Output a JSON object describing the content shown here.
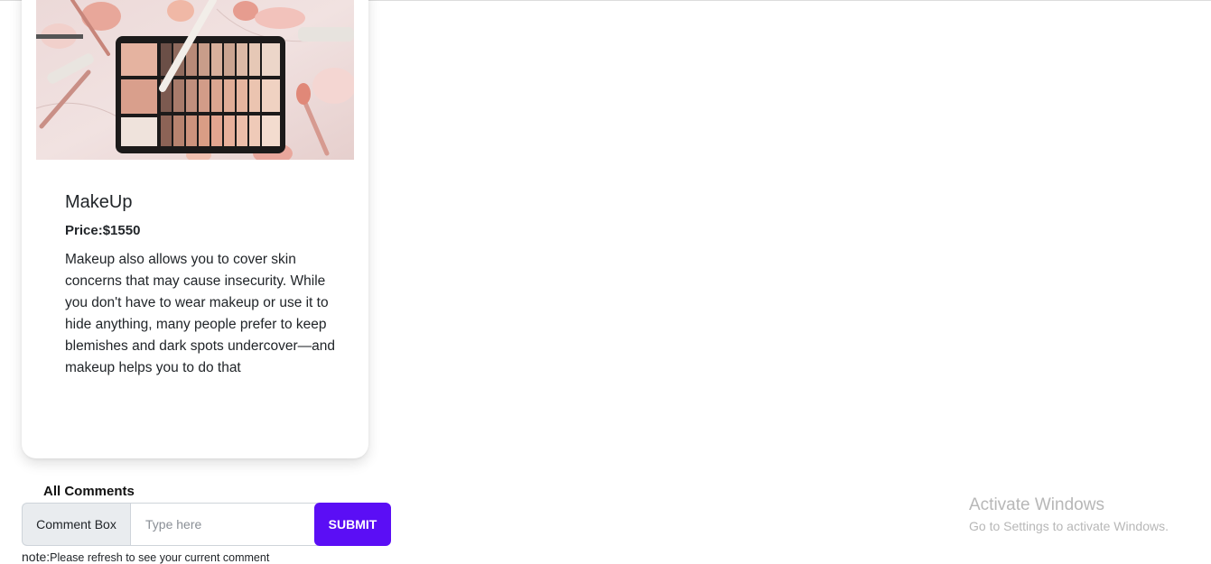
{
  "product": {
    "image_alt": "makeup palette and brushes",
    "title": "MakeUp",
    "price_label": "Price:",
    "price_value": "$1550",
    "description": "Makeup also allows you to cover skin concerns that may cause insecurity. While you don't have to wear makeup or use it to hide anything, many people prefer to keep blemishes and dark spots undercover—and makeup helps you to do that"
  },
  "comments": {
    "heading": "All Comments",
    "box_label": "Comment Box",
    "input_placeholder": "Type here",
    "input_value": "",
    "submit_label": "SUBMIT",
    "note_prefix": "note:",
    "note_text": "Please refresh to see your current comment"
  },
  "watermark": {
    "title": "Activate Windows",
    "subtitle": "Go to Settings to activate Windows."
  },
  "colors": {
    "submit_button": "#5b0ef5",
    "label_background": "#e9ecef",
    "watermark_text": "#b7b7b7"
  }
}
